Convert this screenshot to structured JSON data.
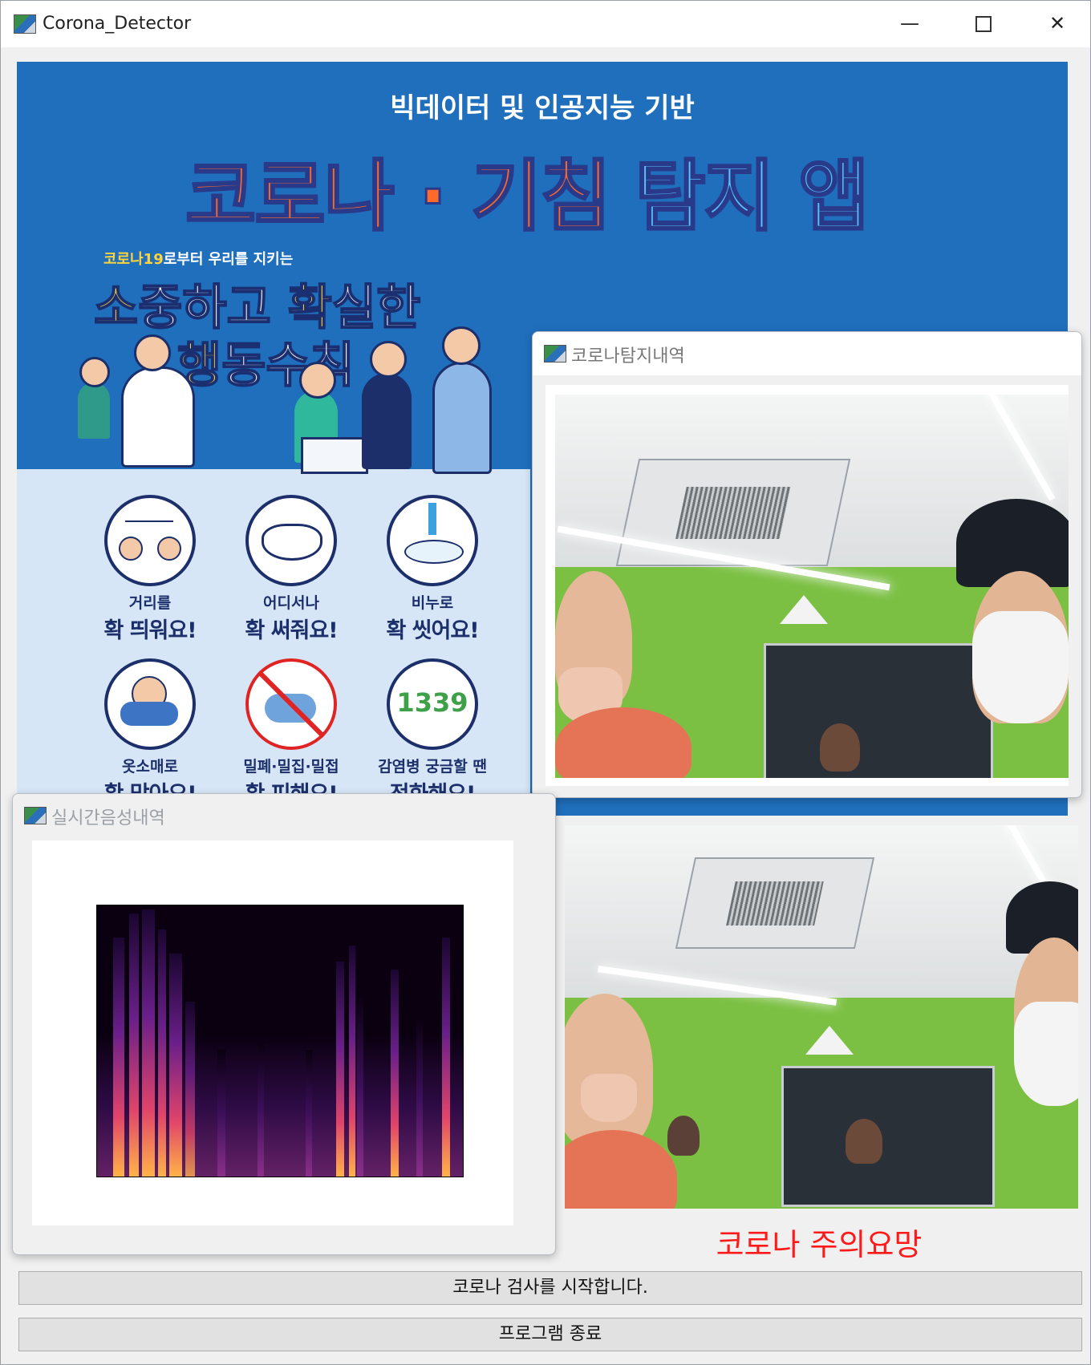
{
  "window": {
    "title": "Corona_Detector",
    "minimize": "—",
    "close": "✕"
  },
  "poster": {
    "subtitle": "빅데이터 및 인공지능 기반",
    "main_title_orange": "코로나 · 기침",
    "main_title_blue": "탐지 앱",
    "tagline_yellow": "코로나19",
    "tagline_white": "로부터 우리를 지키는",
    "slogan_line1_a": "소",
    "slogan_line1_b": "중하고 ",
    "slogan_line1_c": "확",
    "slogan_line1_d": "실한",
    "slogan_line2_a": "행",
    "slogan_line2_b": "동수칙",
    "rules": [
      {
        "line1": "거리를",
        "line2": "확 띄워요!",
        "icon": "distance-icon"
      },
      {
        "line1": "어디서나",
        "line2": "확 써줘요!",
        "icon": "mask-icon"
      },
      {
        "line1": "비누로",
        "line2": "확 씻어요!",
        "icon": "handwash-icon"
      },
      {
        "line1": "옷소매로",
        "line2": "확 막아요!",
        "icon": "sleeve-cough-icon"
      },
      {
        "line1": "밀폐·밀집·밀접",
        "line2": "확 피해요!",
        "icon": "no-crowd-icon"
      },
      {
        "line1": "감염병 궁금할 땐",
        "line2": "전화해요!",
        "icon": "phone-1339-icon"
      }
    ],
    "hotline": "1339"
  },
  "detection_window": {
    "title": "코로나탐지내역"
  },
  "voice_window": {
    "title": "실시간음성내역"
  },
  "status_text": "코로나 주의요망",
  "colors": {
    "status": "#ff1a1a",
    "poster_bg": "#1f6fbd",
    "title_orange": "#ff6a2b",
    "title_blue": "#56c2ff"
  },
  "buttons": {
    "start": "코로나 검사를 시작합니다.",
    "exit": "프로그램 종료"
  }
}
